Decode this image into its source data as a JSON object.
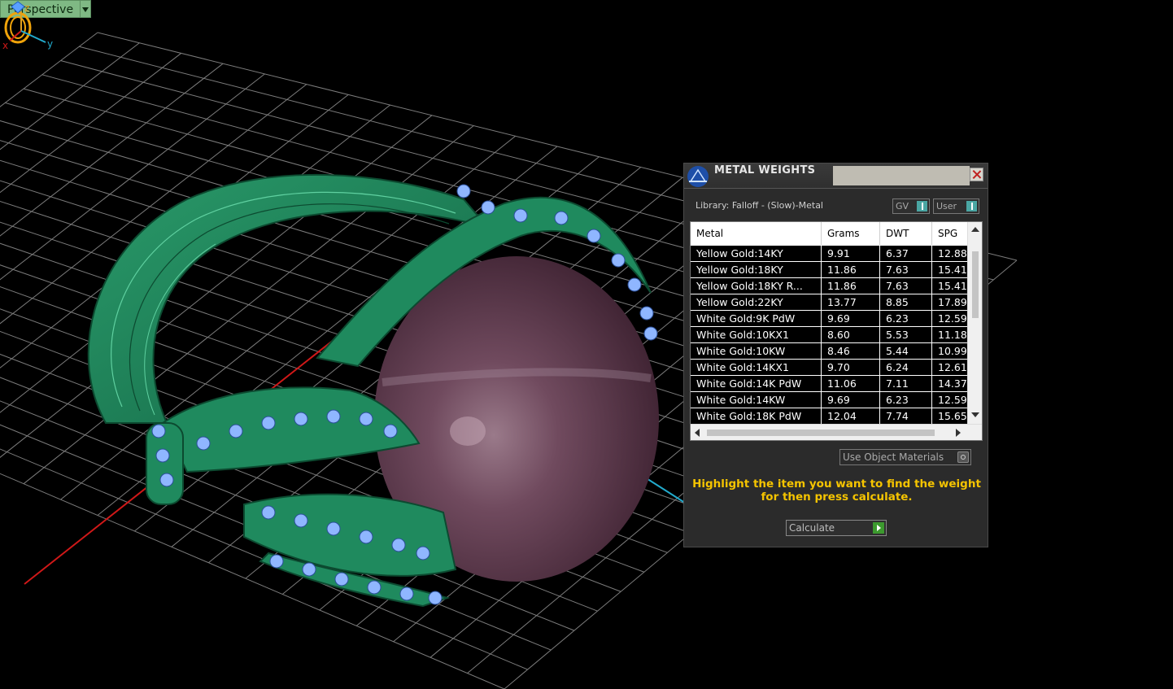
{
  "viewport": {
    "name": "Perspective"
  },
  "dialog": {
    "title": "METAL WEIGHTS",
    "library": "Library: Falloff - (Slow)-Metal",
    "toggles": {
      "gv": "GV",
      "user": "User"
    },
    "columns": [
      "Metal",
      "Grams",
      "DWT",
      "SPG"
    ],
    "rows": [
      [
        "Yellow Gold:14KY",
        "9.91",
        "6.37",
        "12.88"
      ],
      [
        "Yellow Gold:18KY",
        "11.86",
        "7.63",
        "15.41"
      ],
      [
        "Yellow Gold:18KY R...",
        "11.86",
        "7.63",
        "15.41"
      ],
      [
        "Yellow Gold:22KY",
        "13.77",
        "8.85",
        "17.89"
      ],
      [
        "White Gold:9K PdW",
        "9.69",
        "6.23",
        "12.59"
      ],
      [
        "White Gold:10KX1",
        "8.60",
        "5.53",
        "11.18"
      ],
      [
        "White Gold:10KW",
        "8.46",
        "5.44",
        "10.99"
      ],
      [
        "White Gold:14KX1",
        "9.70",
        "6.24",
        "12.61"
      ],
      [
        "White Gold:14K PdW",
        "11.06",
        "7.11",
        "14.37"
      ],
      [
        "White Gold:14KW",
        "9.69",
        "6.23",
        "12.59"
      ],
      [
        "White Gold:18K PdW",
        "12.04",
        "7.74",
        "15.65"
      ]
    ],
    "use_object_materials": "Use Object Materials",
    "hint": "Highlight the item you want to find the weight for then press calculate.",
    "calculate": "Calculate"
  },
  "axes": {
    "z": "z",
    "x": "x",
    "y": "y"
  },
  "colors": {
    "hint": "#f5c400",
    "ring_metal": "#1f8a5e",
    "gem": "#8fb6ff",
    "pearl": "#6e4257",
    "grid": "#8a8a8a"
  }
}
